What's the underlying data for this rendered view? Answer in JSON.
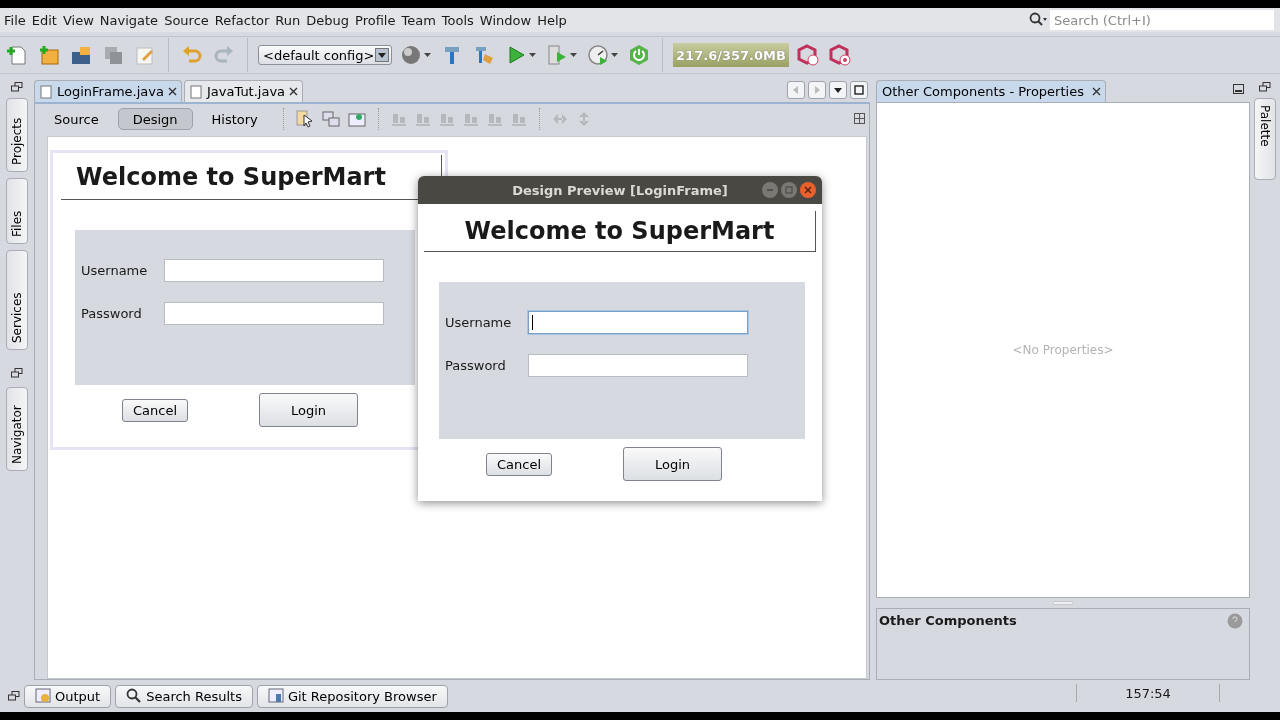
{
  "menu": [
    "File",
    "Edit",
    "View",
    "Navigate",
    "Source",
    "Refactor",
    "Run",
    "Debug",
    "Profile",
    "Team",
    "Tools",
    "Window",
    "Help"
  ],
  "search": {
    "placeholder": "Search (Ctrl+I)"
  },
  "toolbar": {
    "config": "<default config>",
    "memory": "217.6/357.0MB"
  },
  "left_tabs": [
    "Projects",
    "Files",
    "Services",
    "Navigator"
  ],
  "editor_tabs": [
    {
      "label": "LoginFrame.java",
      "selected": true
    },
    {
      "label": "JavaTut.java",
      "selected": false
    }
  ],
  "view_tabs": [
    {
      "label": "Source",
      "selected": false
    },
    {
      "label": "Design",
      "selected": true
    },
    {
      "label": "History",
      "selected": false
    }
  ],
  "form": {
    "title": "Welcome to SuperMart",
    "fields": [
      {
        "label": "Username",
        "focused": false
      },
      {
        "label": "Password",
        "focused": false
      }
    ],
    "buttons": [
      {
        "label": "Cancel",
        "kind": "normal"
      },
      {
        "label": "Login",
        "kind": "default"
      }
    ]
  },
  "preview": {
    "title": "Design Preview [LoginFrame]",
    "heading": "Welcome to SuperMart",
    "fields": [
      {
        "label": "Username",
        "focused": true
      },
      {
        "label": "Password",
        "focused": false
      }
    ],
    "buttons": [
      {
        "label": "Cancel",
        "kind": "normal"
      },
      {
        "label": "Login",
        "kind": "default"
      }
    ]
  },
  "properties": {
    "tab": "Other Components - Properties",
    "empty": "<No Properties>",
    "section": "Other Components"
  },
  "right_tabs": [
    "Palette"
  ],
  "bottom_tabs": [
    "Output",
    "Search Results",
    "Git Repository Browser"
  ],
  "status": {
    "position": "157:54"
  }
}
